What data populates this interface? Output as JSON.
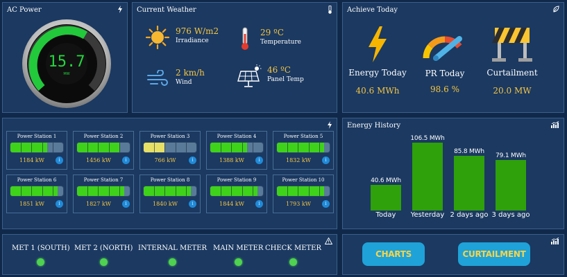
{
  "ac_power": {
    "title": "AC Power",
    "gauge_value": "15.7",
    "gauge_unit": "MW"
  },
  "weather": {
    "title": "Current Weather",
    "items": [
      {
        "value": "976 W/m2",
        "label": "Irradiance",
        "icon": "sun-icon"
      },
      {
        "value": "29 ºC",
        "label": "Temperature",
        "icon": "thermometer-icon"
      },
      {
        "value": "2 km/h",
        "label": "Wind",
        "icon": "wind-icon"
      },
      {
        "value": "46 ºC",
        "label": "Panel Temp",
        "icon": "solar-panel-icon"
      }
    ]
  },
  "achieve": {
    "title": "Achieve Today",
    "items": [
      {
        "label": "Energy Today",
        "value": "40.6 MWh",
        "icon": "lightning-icon"
      },
      {
        "label": "PR Today",
        "value": "98.6 %",
        "icon": "gauge-icon"
      },
      {
        "label": "Curtailment",
        "value": "20.0 MW",
        "icon": "barrier-icon"
      }
    ]
  },
  "stations": [
    {
      "name": "Power Station 1",
      "kw": "1184 kW",
      "level": 0.7,
      "color": "#3fd21a"
    },
    {
      "name": "Power Station 2",
      "kw": "1456 kW",
      "level": 0.8,
      "color": "#3fd21a"
    },
    {
      "name": "Power Station 3",
      "kw": "766 kW",
      "level": 0.4,
      "color": "#e6e066"
    },
    {
      "name": "Power Station 4",
      "kw": "1388 kW",
      "level": 0.7,
      "color": "#3fd21a"
    },
    {
      "name": "Power Station 5",
      "kw": "1832 kW",
      "level": 0.9,
      "color": "#3fd21a"
    },
    {
      "name": "Power Station 6",
      "kw": "1851 kW",
      "level": 0.9,
      "color": "#3fd21a"
    },
    {
      "name": "Power Station 7",
      "kw": "1827 kW",
      "level": 0.9,
      "color": "#3fd21a"
    },
    {
      "name": "Power Station 8",
      "kw": "1840 kW",
      "level": 0.9,
      "color": "#3fd21a"
    },
    {
      "name": "Power Station 9",
      "kw": "1844 kW",
      "level": 0.9,
      "color": "#3fd21a"
    },
    {
      "name": "Power Station 10",
      "kw": "1793 kW",
      "level": 0.9,
      "color": "#3fd21a"
    }
  ],
  "energy_history": {
    "title": "Energy History"
  },
  "chart_data": {
    "type": "bar",
    "categories": [
      "Today",
      "Yesterday",
      "2 days ago",
      "3 days ago"
    ],
    "values": [
      40.6,
      106.5,
      85.8,
      79.1
    ],
    "data_labels": [
      "40.6 MWh",
      "106.5 MWh",
      "85.8 MWh",
      "79.1 MWh"
    ],
    "ylim": [
      0,
      120
    ],
    "grid": false,
    "bar_color": "#2fa10a"
  },
  "meters": [
    {
      "label": "MET 1 (SOUTH)"
    },
    {
      "label": "MET 2 (NORTH)"
    },
    {
      "label": "INTERNAL METER"
    },
    {
      "label": "MAIN METER"
    },
    {
      "label": "CHECK METER"
    }
  ],
  "buttons": {
    "charts": "CHARTS",
    "curtailment": "CURTAILMENT"
  },
  "colors": {
    "accent": "#f5c542",
    "status_ok": "#4fd24f",
    "button": "#1fa2d8"
  }
}
